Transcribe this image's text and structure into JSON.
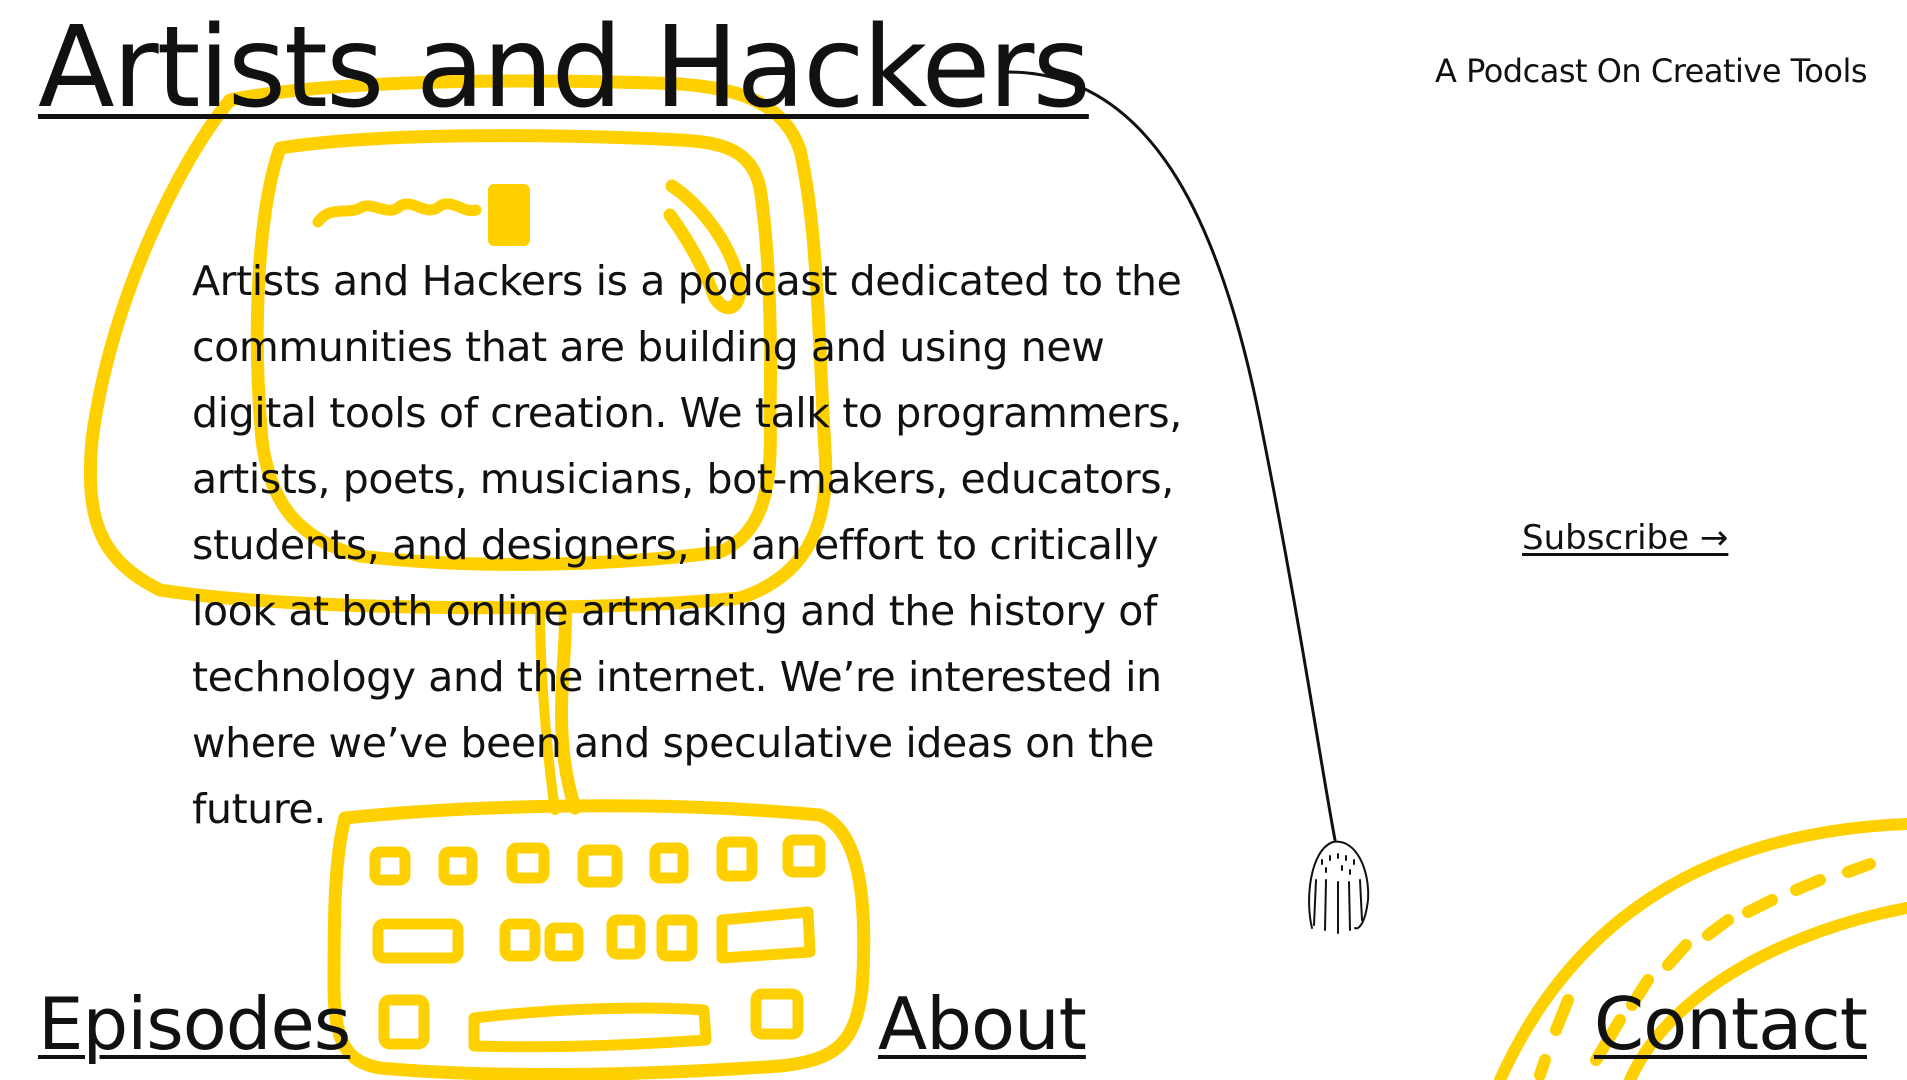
{
  "header": {
    "site_title": "Artists and Hackers",
    "tagline": "A Podcast On Creative Tools"
  },
  "intro": {
    "description": "Artists and Hackers is a podcast dedicated to the communities that are building and using new digital tools of creation. We talk to programmers, artists, poets, musicians, bot-makers, educators, students, and designers, in an effort to critically look at both online artmaking and the history of technology and the internet. We’re interested in where we’ve been and speculative ideas on the future."
  },
  "subscribe": {
    "label": "Subscribe →"
  },
  "nav": {
    "episodes": "Episodes",
    "about": "About",
    "contact": "Contact"
  },
  "colors": {
    "accent_yellow": "#FFD000",
    "text": "#111111",
    "background": "#FFFFFF"
  },
  "illustrations": [
    "computer-doodle",
    "hanging-hand-cord",
    "road-doodle"
  ]
}
